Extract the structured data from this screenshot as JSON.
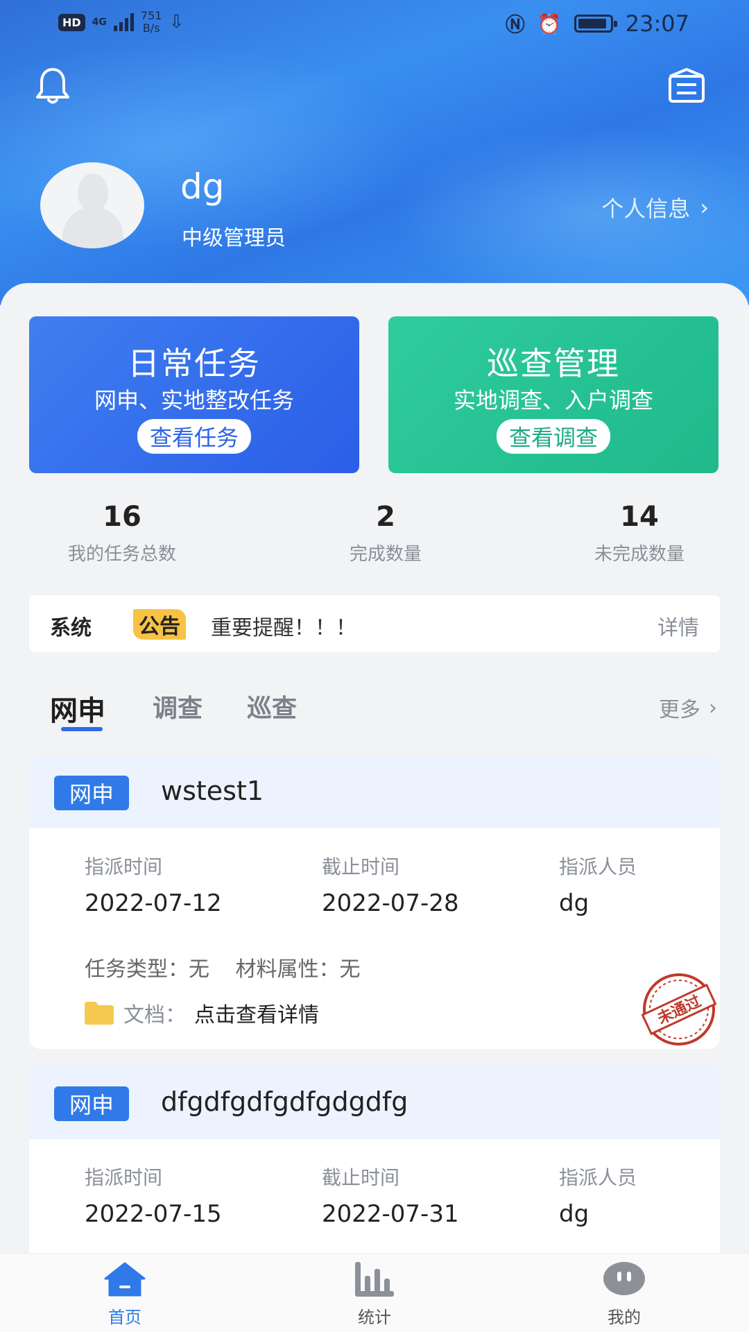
{
  "status_bar": {
    "hd": "HD",
    "signal": "4G",
    "net_speed_value": "751",
    "net_speed_unit": "B/s",
    "time": "23:07"
  },
  "profile": {
    "username": "dg",
    "role": "中级管理员",
    "info_link": "个人信息"
  },
  "cards": [
    {
      "title": "日常任务",
      "subtitle": "网申、实地整改任务",
      "button": "查看任务"
    },
    {
      "title": "巡查管理",
      "subtitle": "实地调查、入户调查",
      "button": "查看调查"
    }
  ],
  "stats": [
    {
      "value": "16",
      "label": "我的任务总数"
    },
    {
      "value": "2",
      "label": "完成数量"
    },
    {
      "value": "14",
      "label": "未完成数量"
    }
  ],
  "notice": {
    "sys": "系统",
    "tag": "公告",
    "message": "重要提醒！！！",
    "detail": "详情"
  },
  "tabs": [
    {
      "label": "网申",
      "active": true
    },
    {
      "label": "调查",
      "active": false
    },
    {
      "label": "巡查",
      "active": false
    }
  ],
  "more_label": "更多",
  "tasks": [
    {
      "badge": "网申",
      "name": "wstest1",
      "assign_time_label": "指派时间",
      "assign_time": "2022-07-12",
      "deadline_label": "截止时间",
      "deadline": "2022-07-28",
      "assignee_label": "指派人员",
      "assignee": "dg",
      "task_type": "任务类型：无",
      "material": "材料属性：无",
      "doc_label": "文档：",
      "doc_link": "点击查看详情",
      "stamp": "未通过"
    },
    {
      "badge": "网申",
      "name": "dfgdfgdfgdfgdgdfg",
      "assign_time_label": "指派时间",
      "assign_time": "2022-07-15",
      "deadline_label": "截止时间",
      "deadline": "2022-07-31",
      "assignee_label": "指派人员",
      "assignee": "dg"
    }
  ],
  "bottom_nav": [
    {
      "label": "首页",
      "icon": "home-icon",
      "active": true
    },
    {
      "label": "统计",
      "icon": "bar-chart-icon",
      "active": false
    },
    {
      "label": "我的",
      "icon": "profile-icon",
      "active": false
    }
  ],
  "colors": {
    "primary": "#2f7ae8",
    "green_card": "#1fb98a",
    "notice_tag": "#f6c344",
    "stamp": "#c0392b"
  }
}
